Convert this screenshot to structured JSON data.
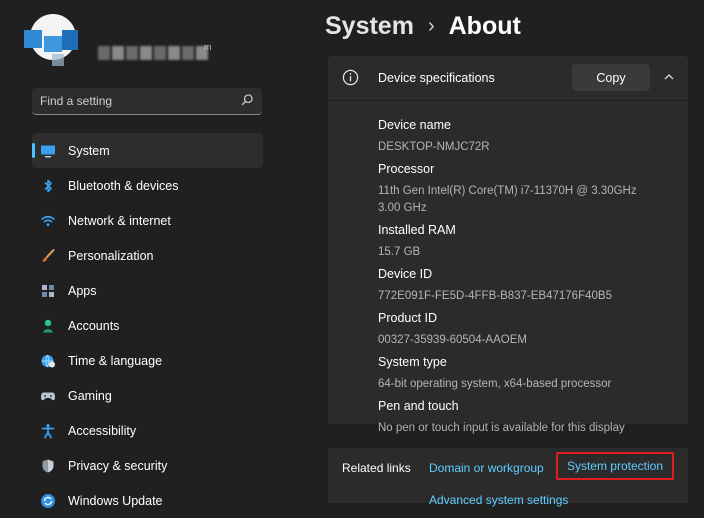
{
  "breadcrumb": {
    "parent": "System",
    "separator": "›",
    "current": "About"
  },
  "user": {
    "superscript": "m"
  },
  "search": {
    "placeholder": "Find a setting"
  },
  "nav": {
    "items": [
      {
        "label": "System",
        "icon": "monitor-icon",
        "active": true
      },
      {
        "label": "Bluetooth & devices",
        "icon": "bluetooth-icon"
      },
      {
        "label": "Network & internet",
        "icon": "wifi-icon"
      },
      {
        "label": "Personalization",
        "icon": "brush-icon"
      },
      {
        "label": "Apps",
        "icon": "apps-icon"
      },
      {
        "label": "Accounts",
        "icon": "person-icon"
      },
      {
        "label": "Time & language",
        "icon": "globe-clock-icon"
      },
      {
        "label": "Gaming",
        "icon": "gamepad-icon"
      },
      {
        "label": "Accessibility",
        "icon": "accessibility-icon"
      },
      {
        "label": "Privacy & security",
        "icon": "shield-icon"
      },
      {
        "label": "Windows Update",
        "icon": "update-icon"
      }
    ]
  },
  "device_specs": {
    "title": "Device specifications",
    "copy_label": "Copy",
    "items": [
      {
        "key": "Device name",
        "value": "DESKTOP-NMJC72R"
      },
      {
        "key": "Processor",
        "value": "11th Gen Intel(R) Core(TM) i7-11370H @ 3.30GHz",
        "value2": "3.00 GHz"
      },
      {
        "key": "Installed RAM",
        "value": "15.7 GB"
      },
      {
        "key": "Device ID",
        "value": "772E091F-FE5D-4FFB-B837-EB47176F40B5"
      },
      {
        "key": "Product ID",
        "value": "00327-35939-60504-AAOEM"
      },
      {
        "key": "System type",
        "value": "64-bit operating system, x64-based processor"
      },
      {
        "key": "Pen and touch",
        "value": "No pen or touch input is available for this display"
      }
    ]
  },
  "related": {
    "label": "Related links",
    "links": [
      "Domain or workgroup",
      "System protection",
      "Advanced system settings"
    ]
  },
  "colors": {
    "accent": "#4cc2ff",
    "link": "#60cdff",
    "highlight": "#e01e1e"
  }
}
